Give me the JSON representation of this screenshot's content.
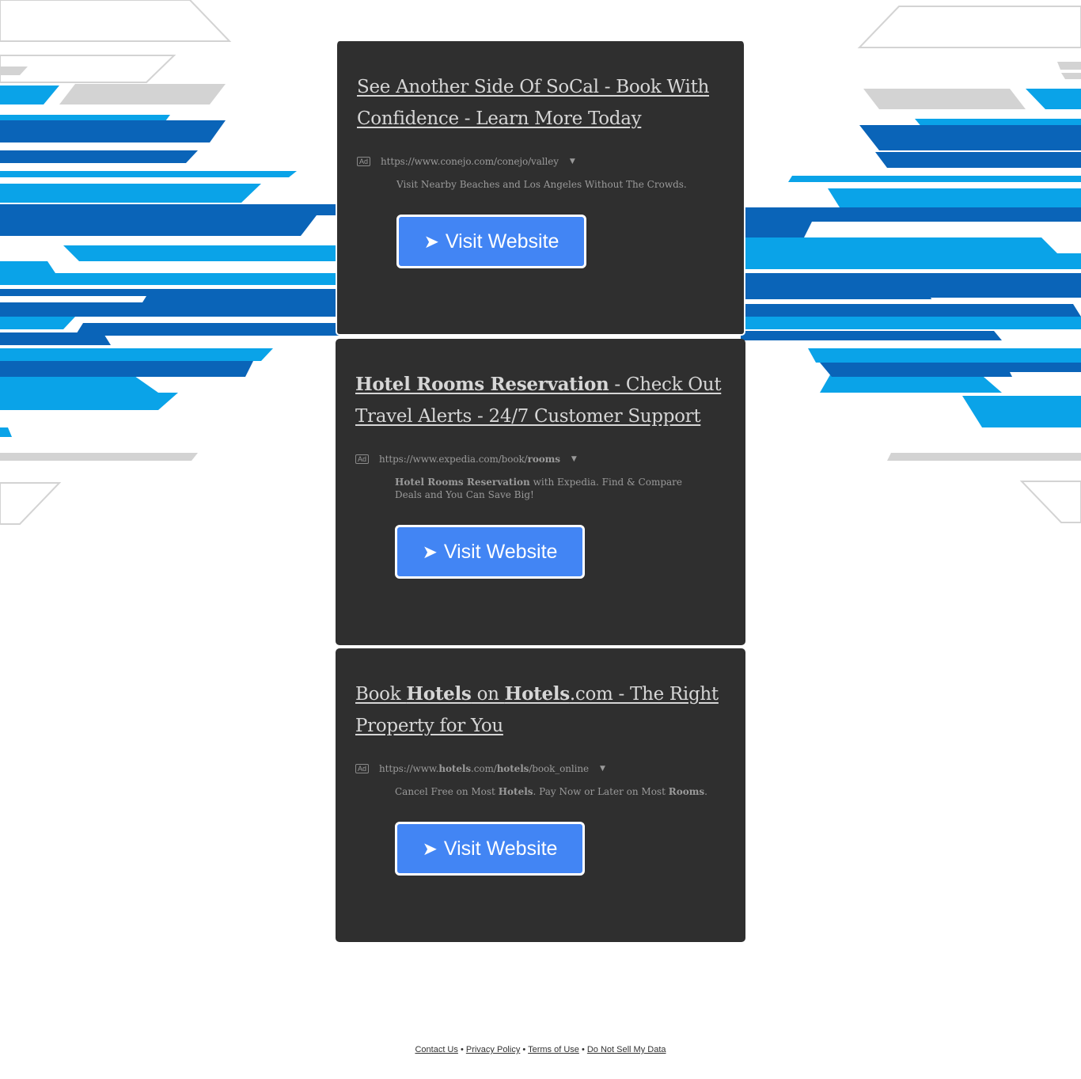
{
  "ads": [
    {
      "title_parts": [
        {
          "text": "See Another Side Of SoCal - Book With Confidence - Learn More Today",
          "bold": false
        }
      ],
      "badge": "Ad",
      "url_parts": [
        {
          "text": "https://www.conejo.com/conejo/valley",
          "bold": false
        }
      ],
      "caret": "▼",
      "desc_parts": [
        {
          "text": "Visit Nearby Beaches and Los Angeles Without The Crowds.",
          "bold": false
        }
      ],
      "button_icon": "➤",
      "button_label": "Visit Website"
    },
    {
      "title_parts": [
        {
          "text": "Hotel Rooms Reservation",
          "bold": true
        },
        {
          "text": " - Check Out Travel Alerts - 24/7 Customer Support",
          "bold": false
        }
      ],
      "badge": "Ad",
      "url_parts": [
        {
          "text": "https://www.expedia.com/book/",
          "bold": false
        },
        {
          "text": "rooms",
          "bold": true
        }
      ],
      "caret": "▼",
      "desc_parts": [
        {
          "text": "Hotel Rooms Reservation",
          "bold": true
        },
        {
          "text": " with Expedia. Find & Compare Deals and You Can Save Big!",
          "bold": false
        }
      ],
      "button_icon": "➤",
      "button_label": "Visit Website"
    },
    {
      "title_parts": [
        {
          "text": "Book ",
          "bold": false
        },
        {
          "text": "Hotels",
          "bold": true
        },
        {
          "text": " on ",
          "bold": false
        },
        {
          "text": "Hotels",
          "bold": true
        },
        {
          "text": ".com - The Right Property for You",
          "bold": false
        }
      ],
      "badge": "Ad",
      "url_parts": [
        {
          "text": "https://www.",
          "bold": false
        },
        {
          "text": "hotels",
          "bold": true
        },
        {
          "text": ".com/",
          "bold": false
        },
        {
          "text": "hotels",
          "bold": true
        },
        {
          "text": "/book_online",
          "bold": false
        }
      ],
      "caret": "▼",
      "desc_parts": [
        {
          "text": "Cancel Free on Most ",
          "bold": false
        },
        {
          "text": "Hotels",
          "bold": true
        },
        {
          "text": ". Pay Now or Later on Most ",
          "bold": false
        },
        {
          "text": "Rooms",
          "bold": true
        },
        {
          "text": ".",
          "bold": false
        }
      ],
      "button_icon": "➤",
      "button_label": "Visit Website"
    }
  ],
  "footer": {
    "links": [
      "Contact Us",
      "Privacy Policy",
      "Terms of Use",
      "Do Not Sell My Data"
    ],
    "separator": " • "
  },
  "colors": {
    "card_bg": "#2f2f2f",
    "button_bg": "#4285f4",
    "stripe_light_blue": "#0aa3e8",
    "stripe_dark_blue": "#0a64b8",
    "stripe_gray": "#d3d3d3"
  }
}
